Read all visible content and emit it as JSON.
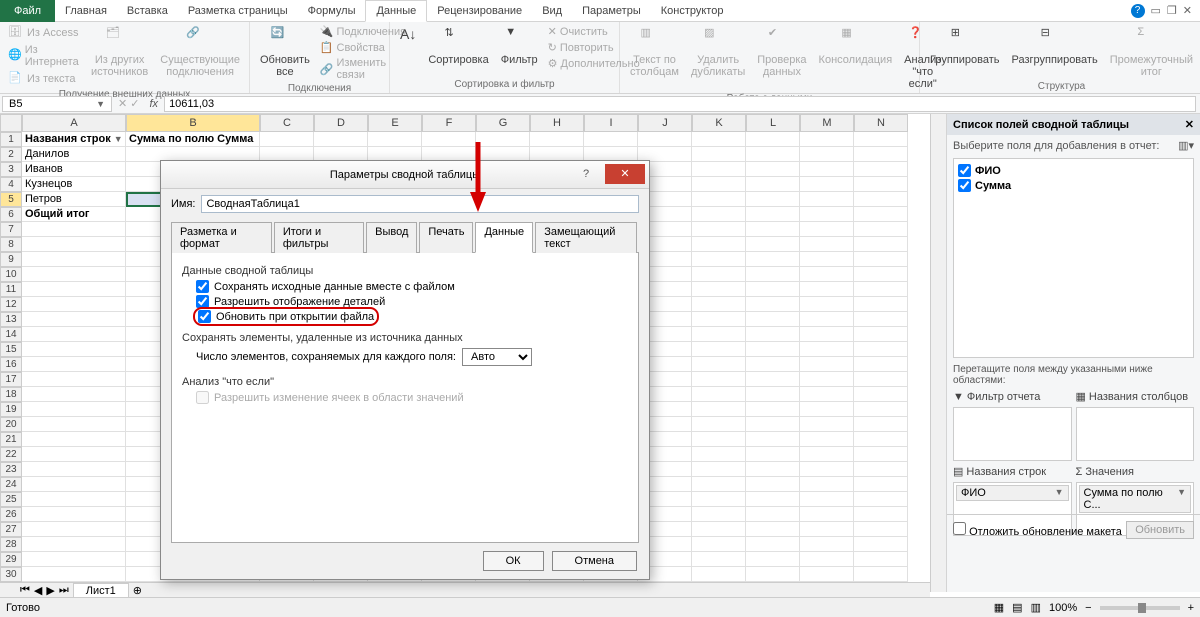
{
  "tabs": {
    "file": "Файл",
    "items": [
      "Главная",
      "Вставка",
      "Разметка страницы",
      "Формулы",
      "Данные",
      "Рецензирование",
      "Вид",
      "Параметры",
      "Конструктор"
    ],
    "active": "Данные"
  },
  "ribbon": {
    "external": {
      "access": "Из Access",
      "web": "Из Интернета",
      "text": "Из текста",
      "other": "Из других источников",
      "existing": "Существующие подключения",
      "label": "Получение внешних данных"
    },
    "connections": {
      "refresh": "Обновить все",
      "conn": "Подключения",
      "props": "Свойства",
      "links": "Изменить связи",
      "label": "Подключения"
    },
    "sort": {
      "sort": "Сортировка",
      "filter": "Фильтр",
      "clear": "Очистить",
      "reapply": "Повторить",
      "advanced": "Дополнительно",
      "label": "Сортировка и фильтр"
    },
    "data": {
      "texttocols": "Текст по столбцам",
      "dedup": "Удалить дубликаты",
      "validate": "Проверка данных",
      "consolidate": "Консолидация",
      "whatif": "Анализ \"что если\"",
      "label": "Работа с данными"
    },
    "structure": {
      "group": "Группировать",
      "ungroup": "Разгруппировать",
      "subtotal": "Промежуточный итог",
      "label": "Структура"
    }
  },
  "namebox": "B5",
  "formula": "10611,03",
  "columns": [
    "A",
    "B",
    "C",
    "D",
    "E",
    "F",
    "G",
    "H",
    "I",
    "J",
    "K",
    "L",
    "M",
    "N"
  ],
  "sheet": {
    "header_a": "Названия строк",
    "header_b": "Сумма по полю Сумма",
    "rows": [
      "Данилов",
      "Иванов",
      "Кузнецов",
      "Петров"
    ],
    "total": "Общий итог"
  },
  "sheet_tab": "Лист1",
  "status": "Готово",
  "zoom": "100%",
  "dialog": {
    "title": "Параметры сводной таблицы",
    "name_label": "Имя:",
    "name_value": "СводнаяТаблица1",
    "tabs": [
      "Разметка и формат",
      "Итоги и фильтры",
      "Вывод",
      "Печать",
      "Данные",
      "Замещающий текст"
    ],
    "active_tab": "Данные",
    "section1": "Данные сводной таблицы",
    "chk1": "Сохранять исходные данные вместе с файлом",
    "chk2": "Разрешить отображение деталей",
    "chk3": "Обновить при открытии файла",
    "section2": "Сохранять элементы, удаленные из источника данных",
    "retain_label": "Число элементов, сохраняемых для каждого поля:",
    "retain_value": "Авто",
    "section3": "Анализ \"что если\"",
    "chk4": "Разрешить изменение ячеек в области значений",
    "ok": "ОК",
    "cancel": "Отмена"
  },
  "fieldpane": {
    "title": "Список полей сводной таблицы",
    "choose": "Выберите поля для добавления в отчет:",
    "fields": [
      "ФИО",
      "Сумма"
    ],
    "drag": "Перетащите поля между указанными ниже областями:",
    "z_filter": "Фильтр отчета",
    "z_cols": "Названия столбцов",
    "z_rows": "Названия строк",
    "z_values": "Значения",
    "row_item": "ФИО",
    "val_item": "Сумма по полю С...",
    "defer": "Отложить обновление макета",
    "update": "Обновить"
  }
}
